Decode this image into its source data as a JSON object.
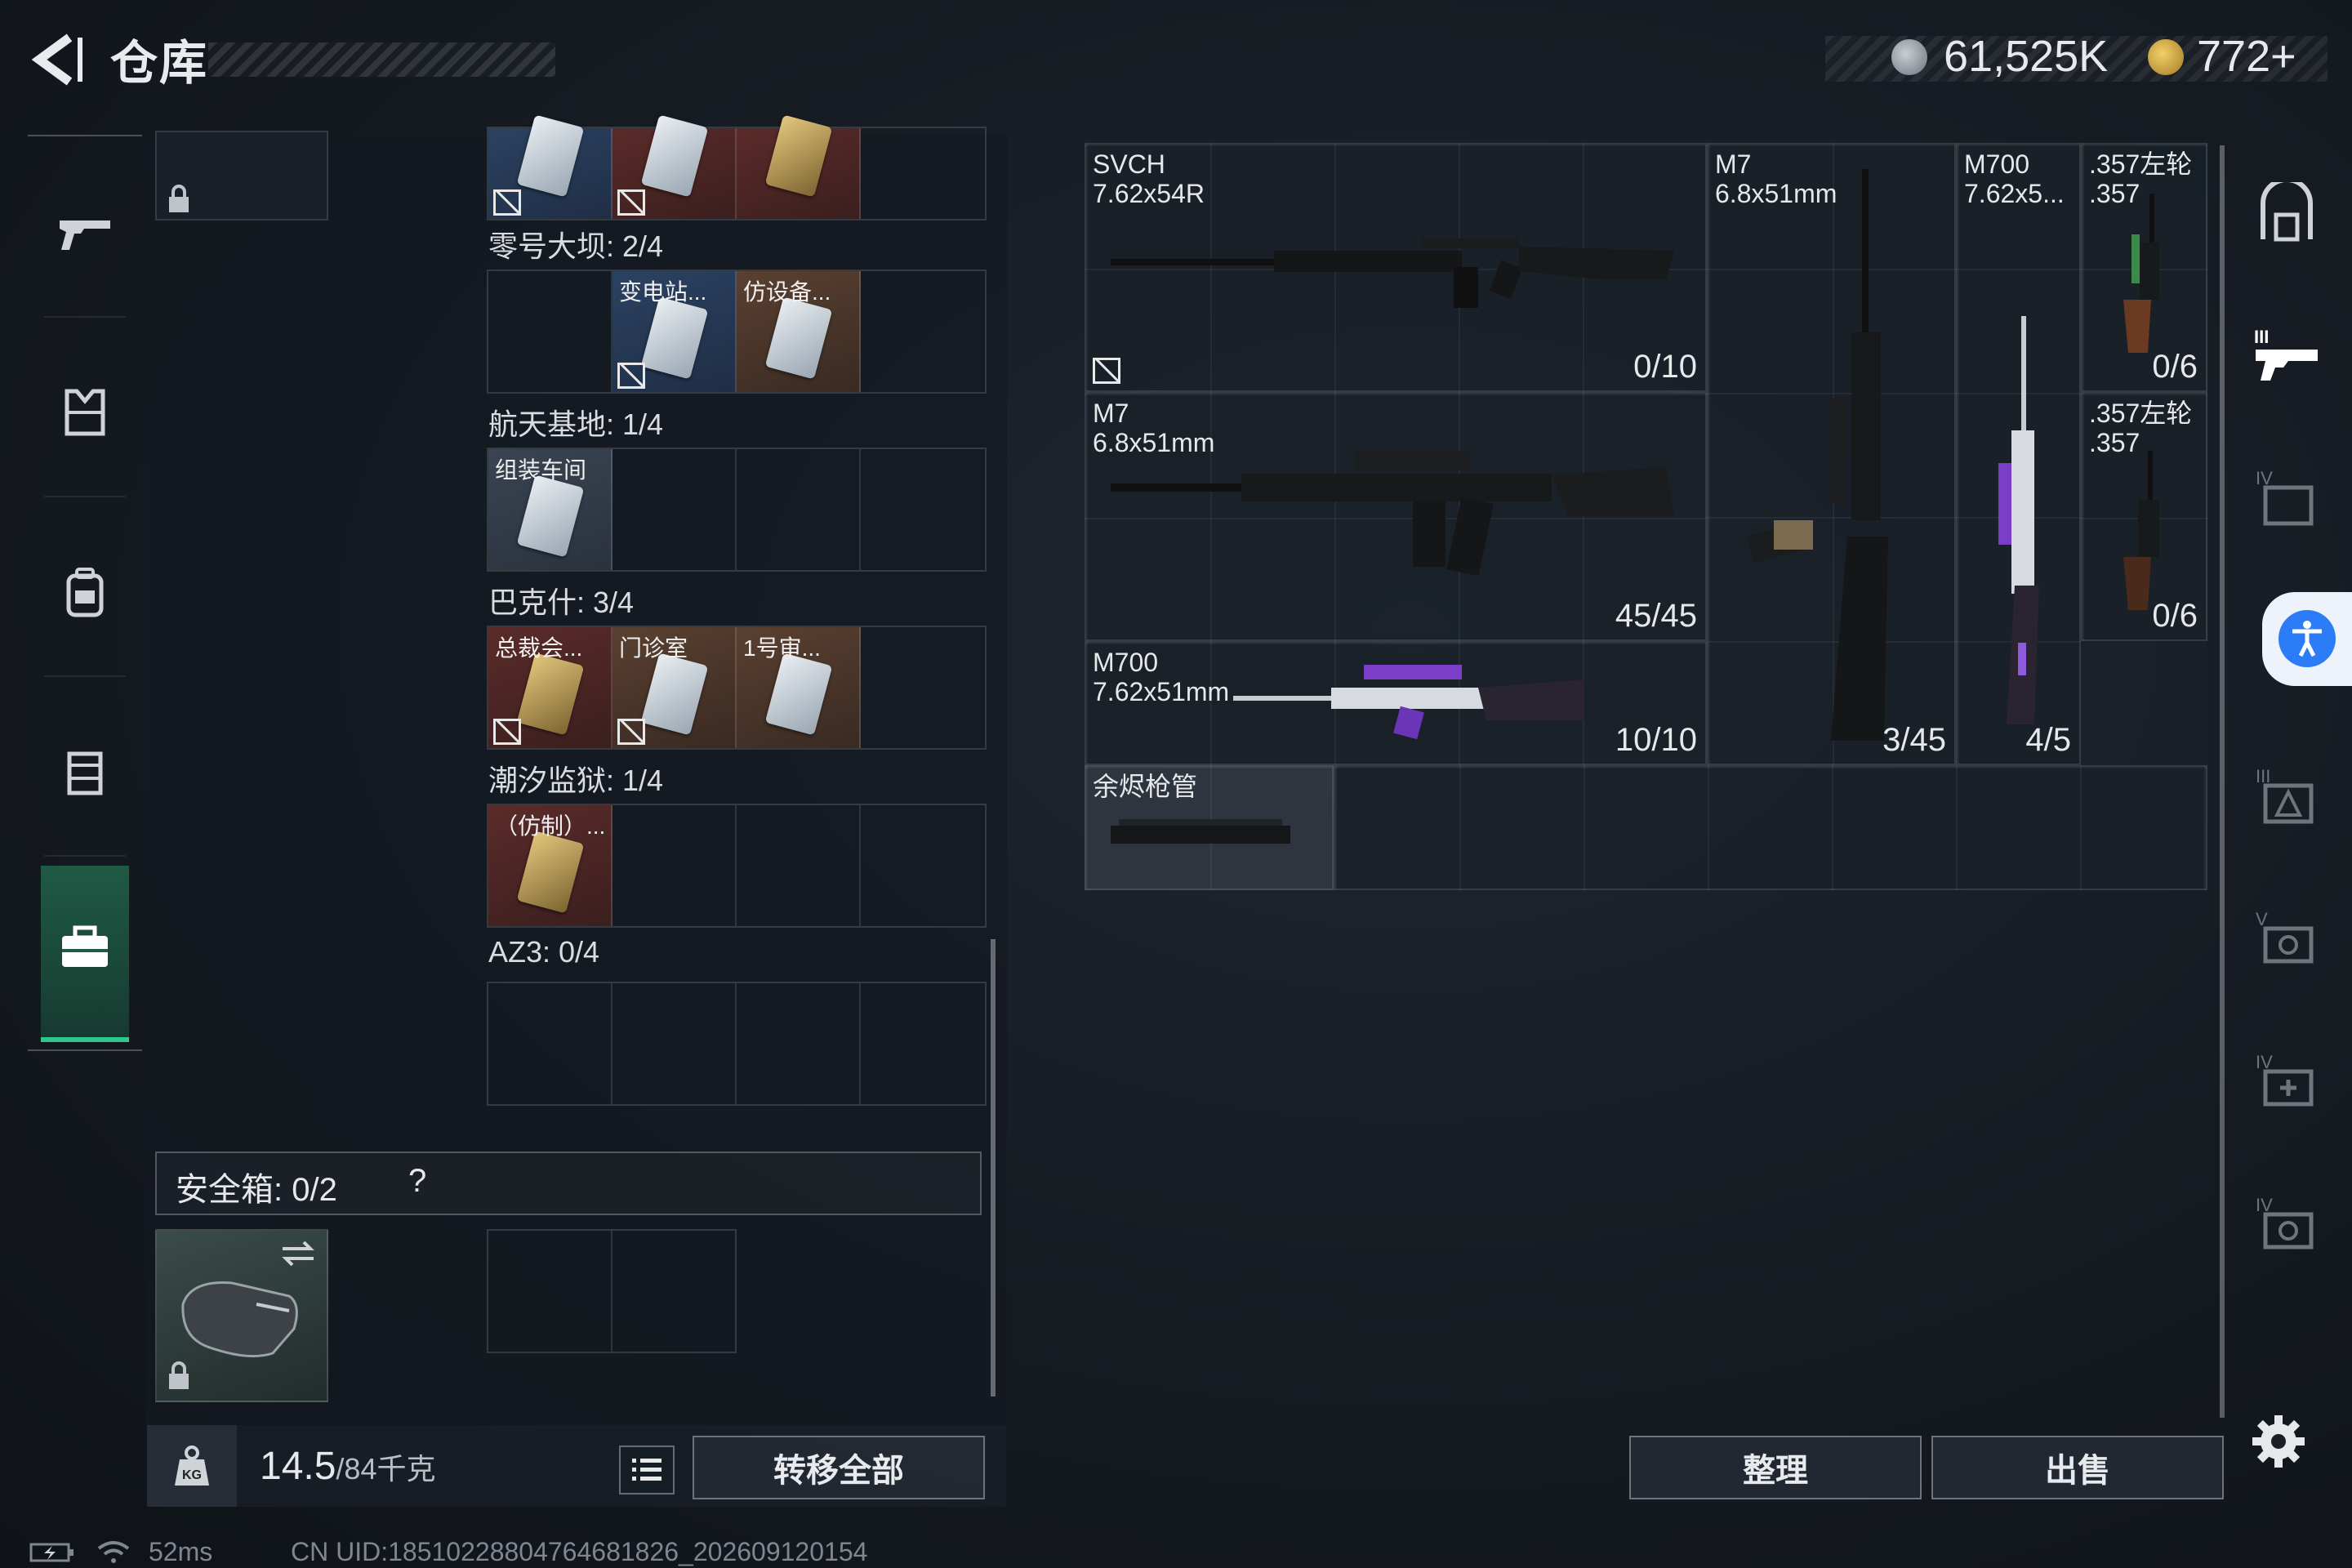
{
  "header": {
    "title": "仓库",
    "currency_1": "61,525K",
    "currency_2": "772+"
  },
  "left_rail": {
    "items": [
      "gun-icon",
      "armor-icon",
      "backpack-icon",
      "chest-rig-icon",
      "toolbox-icon"
    ],
    "active": "toolbox-icon"
  },
  "inventory": {
    "sections": [
      {
        "label": "零号大坝: 2/4"
      },
      {
        "label": "航天基地: 1/4",
        "cards": [
          "变电站...",
          "仿设备..."
        ]
      },
      {
        "label": "巴克什: 3/4",
        "cards": [
          "组装车间"
        ]
      },
      {
        "label": "潮汐监狱: 1/4",
        "cards": [
          "总裁会...",
          "门诊室",
          "1号审..."
        ]
      },
      {
        "label": "AZ3: 0/4",
        "cards": [
          "（仿制）..."
        ]
      }
    ],
    "safebox_label": "安全箱:  0/2",
    "safebox_help": "?",
    "weight_value": "14.5",
    "weight_max": "/84千克",
    "transfer_all": "转移全部"
  },
  "weapons": [
    {
      "name": "SVCH",
      "caliber": "7.62x54R",
      "ammo": "0/10"
    },
    {
      "name": "M7",
      "caliber": "6.8x51mm",
      "ammo": "3/45"
    },
    {
      "name": "M700",
      "caliber": "7.62x5...",
      "ammo": "4/5"
    },
    {
      "name": ".357左轮",
      "caliber": ".357",
      "ammo": "0/6"
    },
    {
      "name": "M7",
      "caliber": "6.8x51mm",
      "ammo": "45/45"
    },
    {
      "name": ".357左轮",
      "caliber": ".357",
      "ammo": "0/6"
    },
    {
      "name": "M700",
      "caliber": "7.62x51mm",
      "ammo": "10/10"
    },
    {
      "name": "余烬枪管",
      "caliber": "",
      "ammo": ""
    }
  ],
  "actions": {
    "sort": "整理",
    "sell": "出售"
  },
  "status_bar": {
    "ping": "52ms",
    "uid": "CN UID:1851022880476468​1826_202609120154"
  },
  "colors": {
    "accent_green": "#2ec98a",
    "accessibility_blue": "#2b7cf6"
  }
}
